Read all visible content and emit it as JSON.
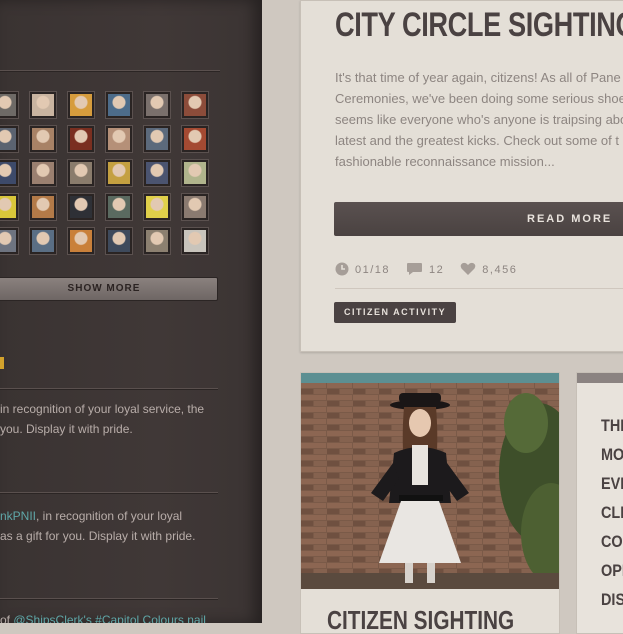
{
  "sidebar": {
    "show_more_label": "SHOW MORE",
    "award_1_text_line1": "in recognition of your loyal service, the",
    "award_1_text_line2": "you. Display it with pride.",
    "award_2_link": "nkPNII",
    "award_2_text_line1": ", in recognition of your loyal",
    "award_2_text_line2": "as a gift for you. Display it with pride.",
    "award_3_prefix": "of ",
    "award_3_link": "@ShipsClerk's #Capitol Colours nail",
    "avatar_colors": [
      "#6e6a66",
      "#c9b4a0",
      "#d69c3d",
      "#4d6c8a",
      "#7a706c",
      "#8c4c3a",
      "#5b6370",
      "#a88266",
      "#7a2f20",
      "#b59078",
      "#5c6a7c",
      "#a44a32",
      "#3d4a6a",
      "#9b8070",
      "#8a7c6c",
      "#c4a040",
      "#4b5470",
      "#b0b48c",
      "#d8c63a",
      "#b37a48",
      "#2e3036",
      "#5a6a60",
      "#e0d04a",
      "#8a7a70",
      "#6e7480",
      "#5a6e84",
      "#c9803a",
      "#3e4a5c",
      "#8c8070",
      "#c8c4bc"
    ]
  },
  "post_main": {
    "title": "CITY CIRCLE SIGHTINGS",
    "body_lines": [
      "It's that time of year again, citizens! As all of Pane",
      "Ceremonies, we've been doing some serious shoe",
      "seems like everyone who's anyone is traipsing abo",
      "latest and the greatest kicks. Check out some of t",
      "fashionable reconnaissance mission..."
    ],
    "read_more_label": "READ MORE",
    "date": "01/18",
    "comments": "12",
    "likes": "8,456",
    "tag": "CITIZEN ACTIVITY"
  },
  "post_photo": {
    "title": "CITIZEN SIGHTING",
    "accent_color": "#5c8f92"
  },
  "post_right": {
    "words": [
      "THE",
      "MO",
      "EVE",
      "CLE",
      "CO",
      "OPI",
      "DIS"
    ]
  }
}
